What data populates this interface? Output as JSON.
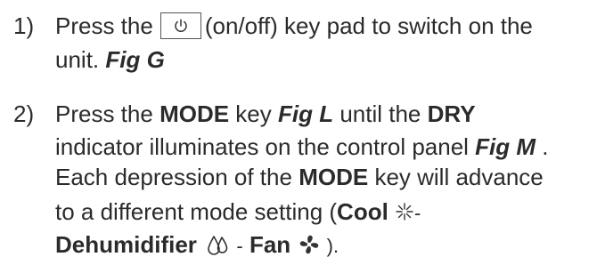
{
  "step1": {
    "number": "1)",
    "press_the": "Press the",
    "key_desc": "(on/off) key pad to switch on the",
    "line2_text": "unit.",
    "fig_ref": "Fig G"
  },
  "step2": {
    "number": "2)",
    "press_the": "Press the",
    "mode_key": "MODE",
    "key_word": "key",
    "fig_l": "Fig L",
    "until_the": "until the",
    "dry": "DRY",
    "indicator_text": "indicator illuminates on the control panel",
    "fig_m": "Fig M",
    "period": ".",
    "each_depression": "Each depression of the",
    "mode_key2": "MODE",
    "will_advance": "key will advance",
    "different_mode": "to a different mode setting (",
    "cool": "Cool",
    "dash1": "-",
    "dehumidifier": "Dehumidifier",
    "dash2": "-",
    "fan": "Fan",
    "close_paren": ")."
  },
  "icons": {
    "power": "power-icon",
    "cool": "snowflake-icon",
    "dehumidifier": "water-drops-icon",
    "fan": "fan-icon"
  },
  "colors": {
    "text": "#2b2b2b",
    "border": "#555555"
  }
}
